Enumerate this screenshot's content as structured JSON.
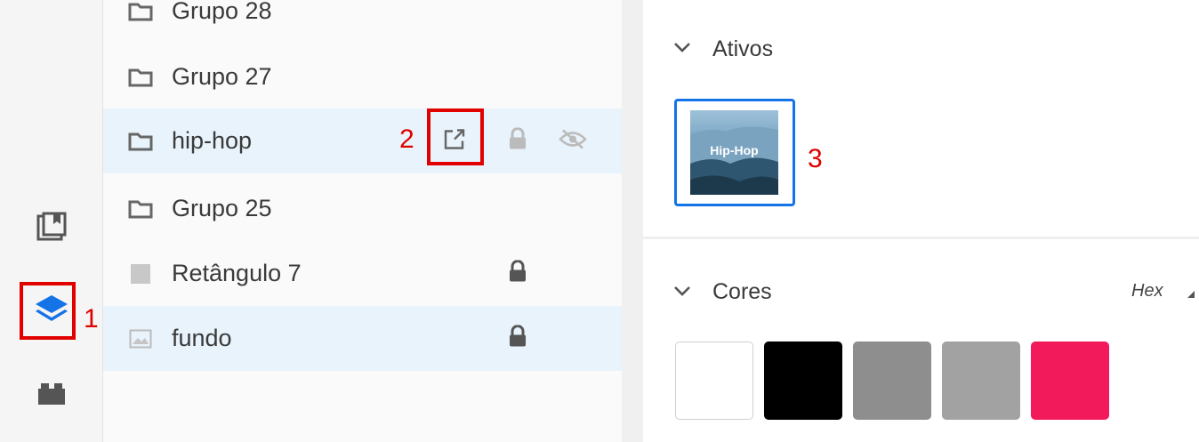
{
  "layers": [
    {
      "label": "Grupo 28",
      "type": "folder",
      "selected": false,
      "locked": false
    },
    {
      "label": "Grupo 27",
      "type": "folder",
      "selected": false,
      "locked": false
    },
    {
      "label": "hip-hop",
      "type": "folder",
      "selected": true,
      "locked": false
    },
    {
      "label": "Grupo 25",
      "type": "folder",
      "selected": false,
      "locked": false
    },
    {
      "label": "Retângulo 7",
      "type": "rectangle",
      "selected": false,
      "locked": true
    },
    {
      "label": "fundo",
      "type": "image",
      "selected": true,
      "locked": true
    }
  ],
  "annotations": {
    "a1": "1",
    "a2": "2",
    "a3": "3"
  },
  "assets": {
    "title": "Ativos",
    "thumb_text": "Hip-Hop"
  },
  "colors": {
    "title": "Cores",
    "mode": "Hex",
    "swatches": [
      "#ffffff",
      "#000000",
      "#8e8e8e",
      "#a2a2a2",
      "#f21a5a"
    ]
  },
  "icons": [
    "documents-icon",
    "layers-icon",
    "plugins-icon",
    "folder-icon",
    "rectangle-icon",
    "image-icon",
    "export-icon",
    "lock-icon",
    "hidden-eye-icon",
    "chevron-down-icon"
  ]
}
